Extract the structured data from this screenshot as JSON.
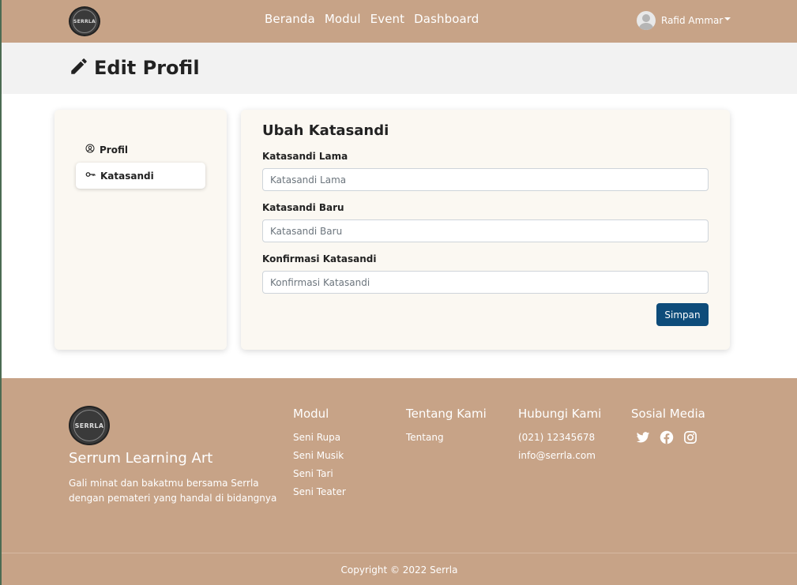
{
  "navbar": {
    "logo_text": "SERRLA",
    "links": [
      "Beranda",
      "Modul",
      "Event",
      "Dashboard"
    ],
    "user_name": "Rafid Ammar"
  },
  "page": {
    "title": "Edit Profil"
  },
  "sidebar": {
    "items": [
      {
        "label": "Profil",
        "icon": "user-circle-icon",
        "active": false
      },
      {
        "label": "Katasandi",
        "icon": "key-icon",
        "active": true
      }
    ]
  },
  "form": {
    "title": "Ubah Katasandi",
    "fields": [
      {
        "label": "Katasandi Lama",
        "placeholder": "Katasandi Lama",
        "value": ""
      },
      {
        "label": "Katasandi Baru",
        "placeholder": "Katasandi Baru",
        "value": ""
      },
      {
        "label": "Konfirmasi Katasandi",
        "placeholder": "Konfirmasi Katasandi",
        "value": ""
      }
    ],
    "submit_label": "Simpan"
  },
  "footer": {
    "logo_text": "SERRLA",
    "brand": "Serrum Learning Art",
    "tagline": "Gali minat dan bakatmu bersama Serrla dengan pemateri yang handal di bidangnya",
    "columns": [
      {
        "title": "Modul",
        "links": [
          "Seni Rupa",
          "Seni Musik",
          "Seni Tari",
          "Seni Teater"
        ]
      },
      {
        "title": "Tentang Kami",
        "links": [
          "Tentang"
        ]
      },
      {
        "title": "Hubungi Kami",
        "links": [
          "(021) 12345678",
          "info@serrla.com"
        ]
      },
      {
        "title": "Sosial Media",
        "icons": [
          "twitter-icon",
          "facebook-icon",
          "instagram-icon"
        ]
      }
    ],
    "copyright": "Copyright © 2022 Serrla"
  },
  "colors": {
    "brand_tan": "#c7a387",
    "primary_button": "#0e4c7a",
    "card_bg": "#fbf8f2",
    "header_bg": "#f2f2f2"
  }
}
